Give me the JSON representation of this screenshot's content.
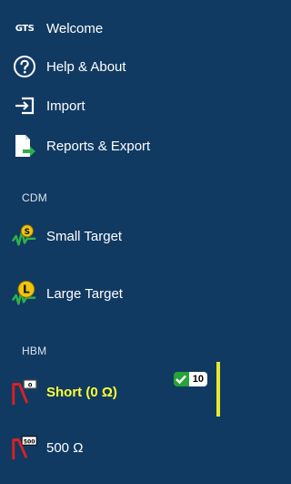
{
  "colors": {
    "background": "#113a62",
    "text": "#ffffff",
    "selected_text": "#ffff33",
    "selection_bar": "#e9e82c",
    "badge_check": "#27a339"
  },
  "menu": {
    "welcome": {
      "logo_text": "GTS",
      "label": "Welcome"
    },
    "help": {
      "icon": "question-circle-icon",
      "label": "Help & About"
    },
    "import": {
      "icon": "import-icon",
      "label": "Import"
    },
    "reports": {
      "icon": "document-export-icon",
      "label": "Reports & Export"
    }
  },
  "sections": {
    "cdm": {
      "label": "CDM",
      "items": [
        {
          "label": "Small Target",
          "icon_letter": "S",
          "icon": "small-target-icon"
        },
        {
          "label": "Large Target",
          "icon_letter": "L",
          "icon": "large-target-icon"
        }
      ]
    },
    "hbm": {
      "label": "HBM",
      "items": [
        {
          "label": "Short (0 Ω)",
          "icon": "short-resistor-icon",
          "resistor_text": "0",
          "selected": true,
          "badge_count": "10"
        },
        {
          "label": "500 Ω",
          "icon": "resistor-500-icon",
          "resistor_text": "500",
          "selected": false
        }
      ]
    }
  }
}
